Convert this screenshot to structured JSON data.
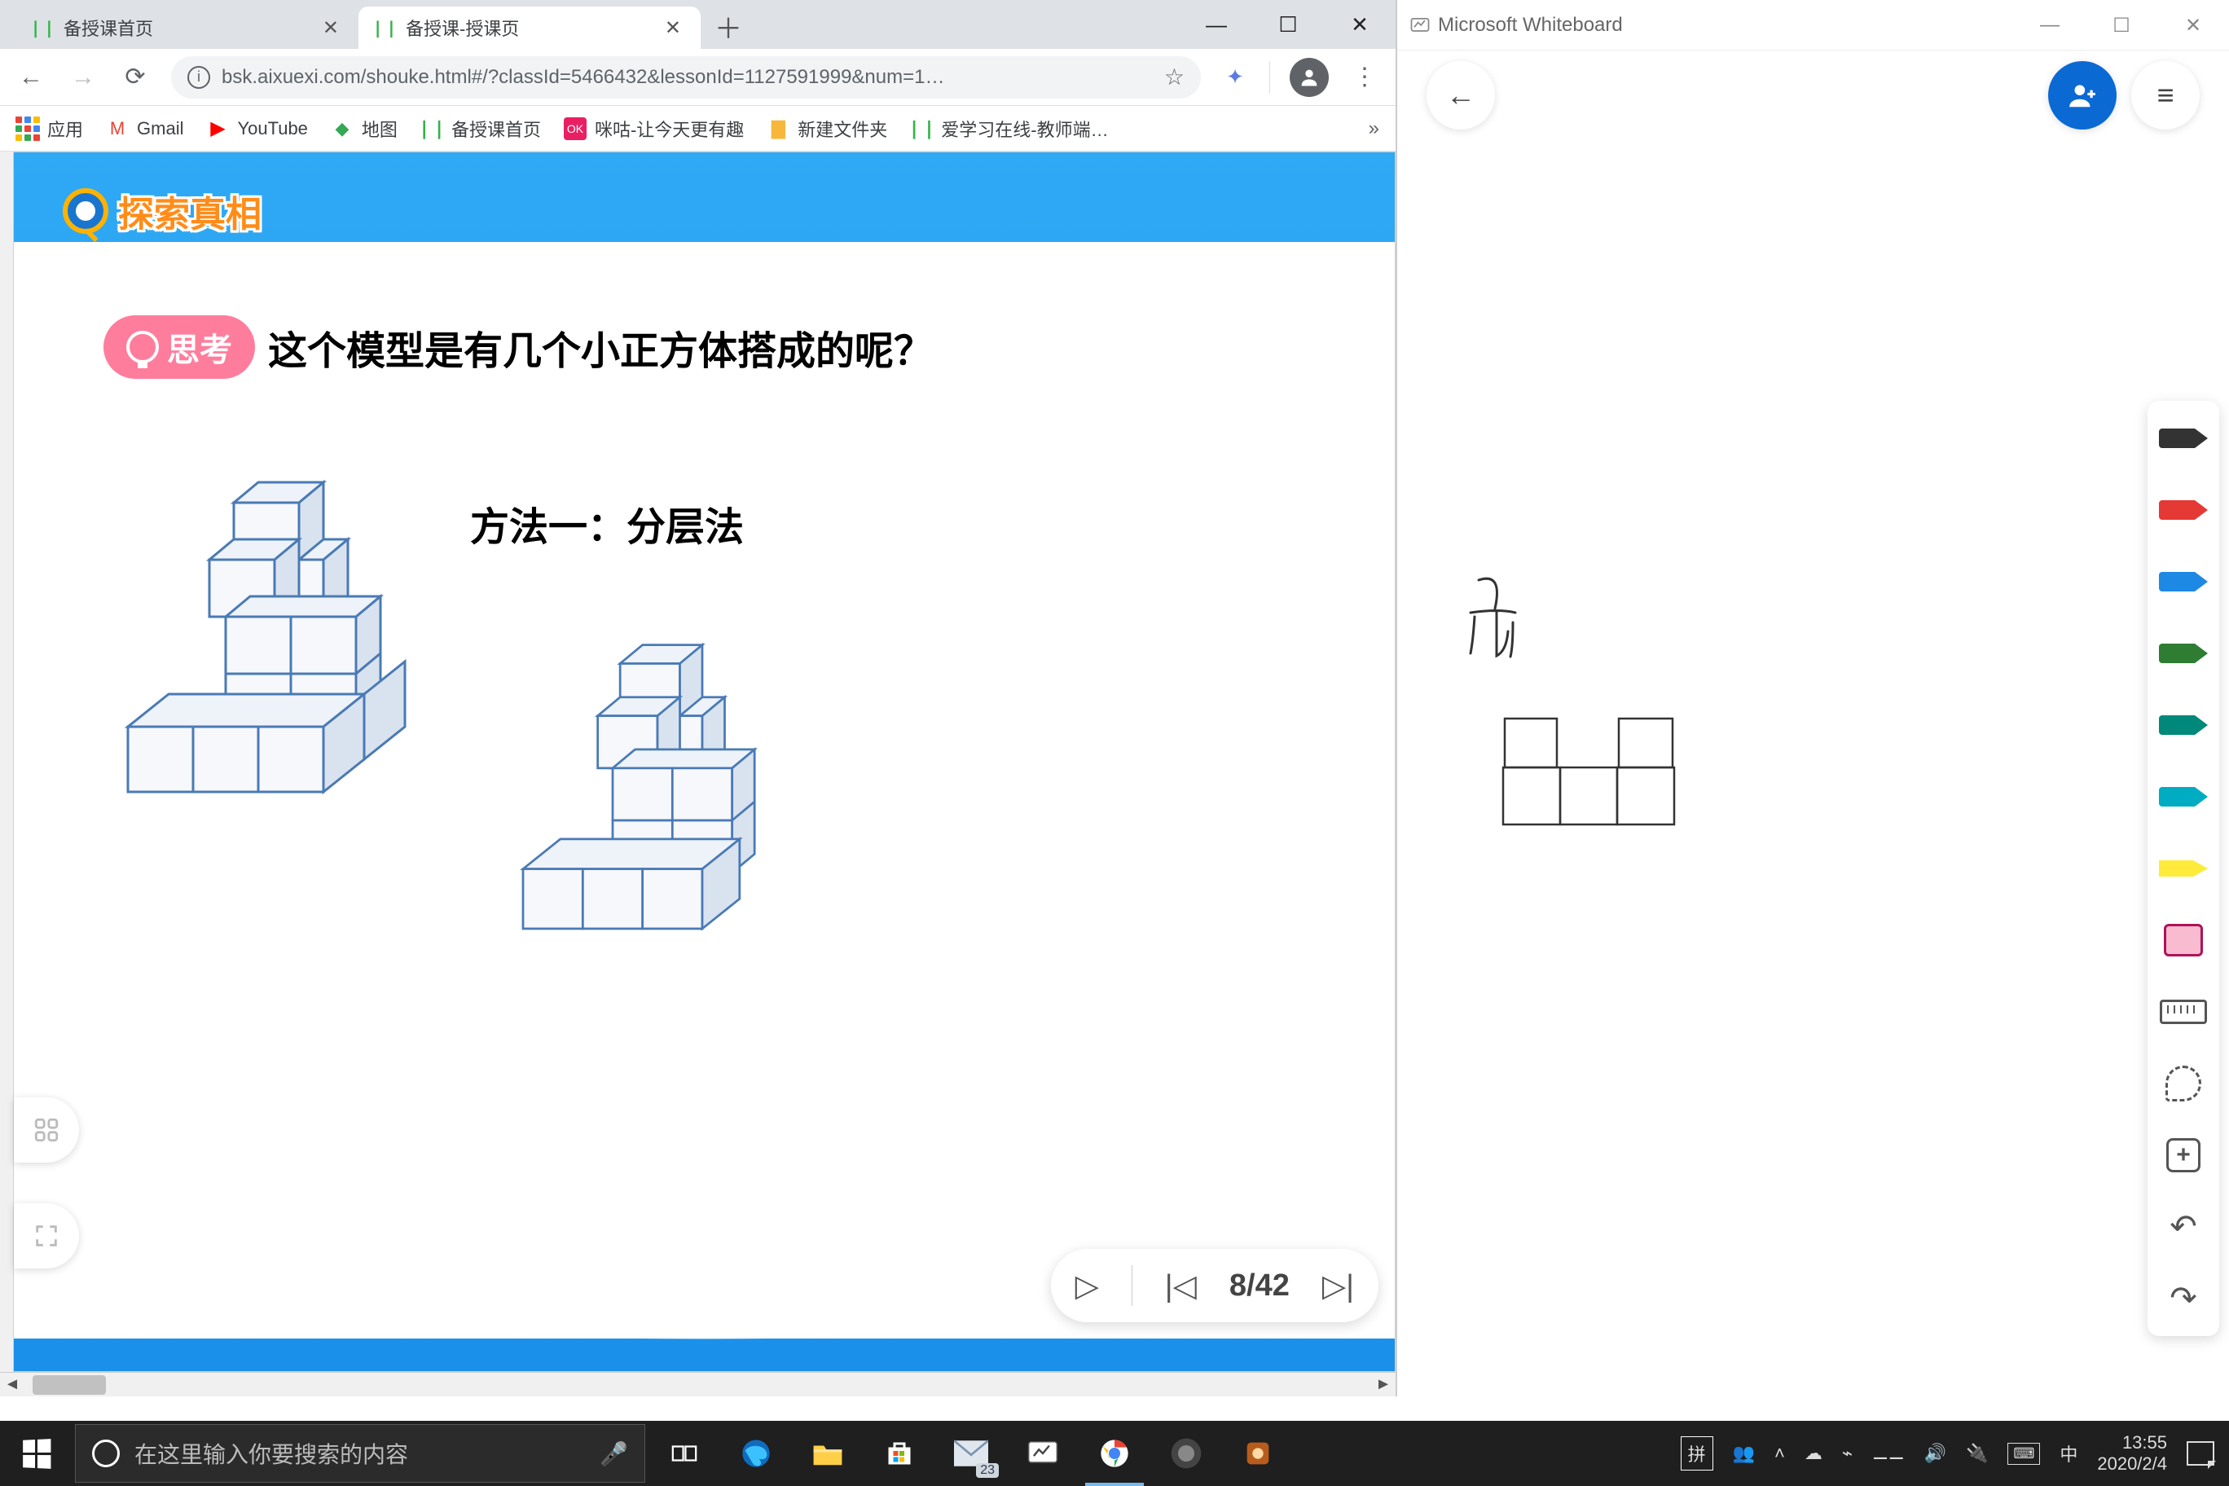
{
  "chrome": {
    "tabs": [
      {
        "label": "备授课首页",
        "active": false
      },
      {
        "label": "备授课-授课页",
        "active": true
      }
    ],
    "url": "bsk.aixuexi.com/shouke.html#/?classId=5466432&lessonId=1127591999&num=1…",
    "bookmarks": [
      {
        "label": "应用"
      },
      {
        "label": "Gmail"
      },
      {
        "label": "YouTube"
      },
      {
        "label": "地图"
      },
      {
        "label": "备授课首页"
      },
      {
        "label": "咪咕-让今天更有趣"
      },
      {
        "label": "新建文件夹"
      },
      {
        "label": "爱学习在线-教师端…"
      }
    ]
  },
  "slide": {
    "section_badge": "探索真相",
    "think_label": "思考",
    "question": "这个模型是有几个小正方体搭成的呢？",
    "method": "方法一：分层法",
    "page_current": 8,
    "page_total": 42
  },
  "whiteboard": {
    "title": "Microsoft Whiteboard",
    "annotation": "前"
  },
  "taskbar": {
    "search_placeholder": "在这里输入你要搜索的内容",
    "ime": "拼",
    "lang": "中",
    "time": "13:55",
    "date": "2020/2/4",
    "mail_badge": "23"
  }
}
